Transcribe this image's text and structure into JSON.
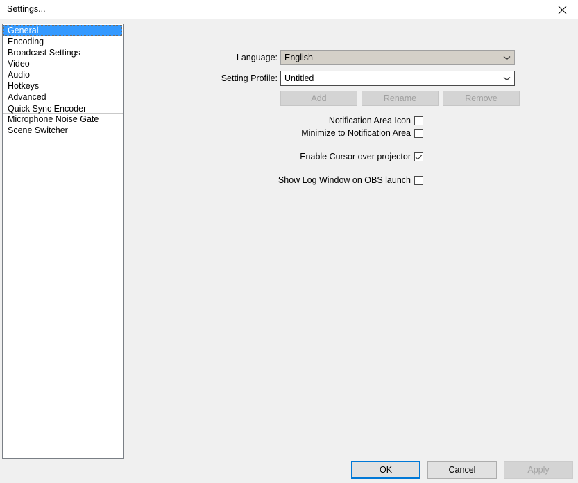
{
  "window": {
    "title": "Settings...",
    "close_icon": "close-icon"
  },
  "categories": [
    {
      "label": "General",
      "selected": true,
      "sep_top": false,
      "sep_bottom": false
    },
    {
      "label": "Encoding",
      "selected": false,
      "sep_top": false,
      "sep_bottom": false
    },
    {
      "label": "Broadcast Settings",
      "selected": false,
      "sep_top": false,
      "sep_bottom": false
    },
    {
      "label": "Video",
      "selected": false,
      "sep_top": false,
      "sep_bottom": false
    },
    {
      "label": "Audio",
      "selected": false,
      "sep_top": false,
      "sep_bottom": false
    },
    {
      "label": "Hotkeys",
      "selected": false,
      "sep_top": false,
      "sep_bottom": false
    },
    {
      "label": "Advanced",
      "selected": false,
      "sep_top": false,
      "sep_bottom": false
    },
    {
      "label": "Quick Sync Encoder",
      "selected": false,
      "sep_top": true,
      "sep_bottom": true
    },
    {
      "label": "Microphone Noise Gate",
      "selected": false,
      "sep_top": false,
      "sep_bottom": false
    },
    {
      "label": "Scene Switcher",
      "selected": false,
      "sep_top": false,
      "sep_bottom": false
    }
  ],
  "general": {
    "language": {
      "label": "Language:",
      "value": "English",
      "arrow_icon": "chevron-down-icon"
    },
    "setting_profile": {
      "label": "Setting Profile:",
      "value": "Untitled",
      "arrow_icon": "chevron-down-icon"
    },
    "profile_buttons": {
      "add": "Add",
      "rename": "Rename",
      "remove": "Remove"
    },
    "checkboxes": [
      {
        "label": "Notification Area Icon",
        "checked": false
      },
      {
        "label": "Minimize to Notification Area",
        "checked": false
      },
      {
        "label": "Enable Cursor over projector",
        "checked": true
      },
      {
        "label": "Show Log Window on OBS launch",
        "checked": false
      }
    ]
  },
  "dialog_buttons": {
    "ok": "OK",
    "cancel": "Cancel",
    "apply": "Apply"
  },
  "colors": {
    "selection_blue": "#3399ff",
    "focus_blue": "#0078d7",
    "window_bg": "#f0f0f0",
    "titlebar_bg": "#ffffff"
  }
}
